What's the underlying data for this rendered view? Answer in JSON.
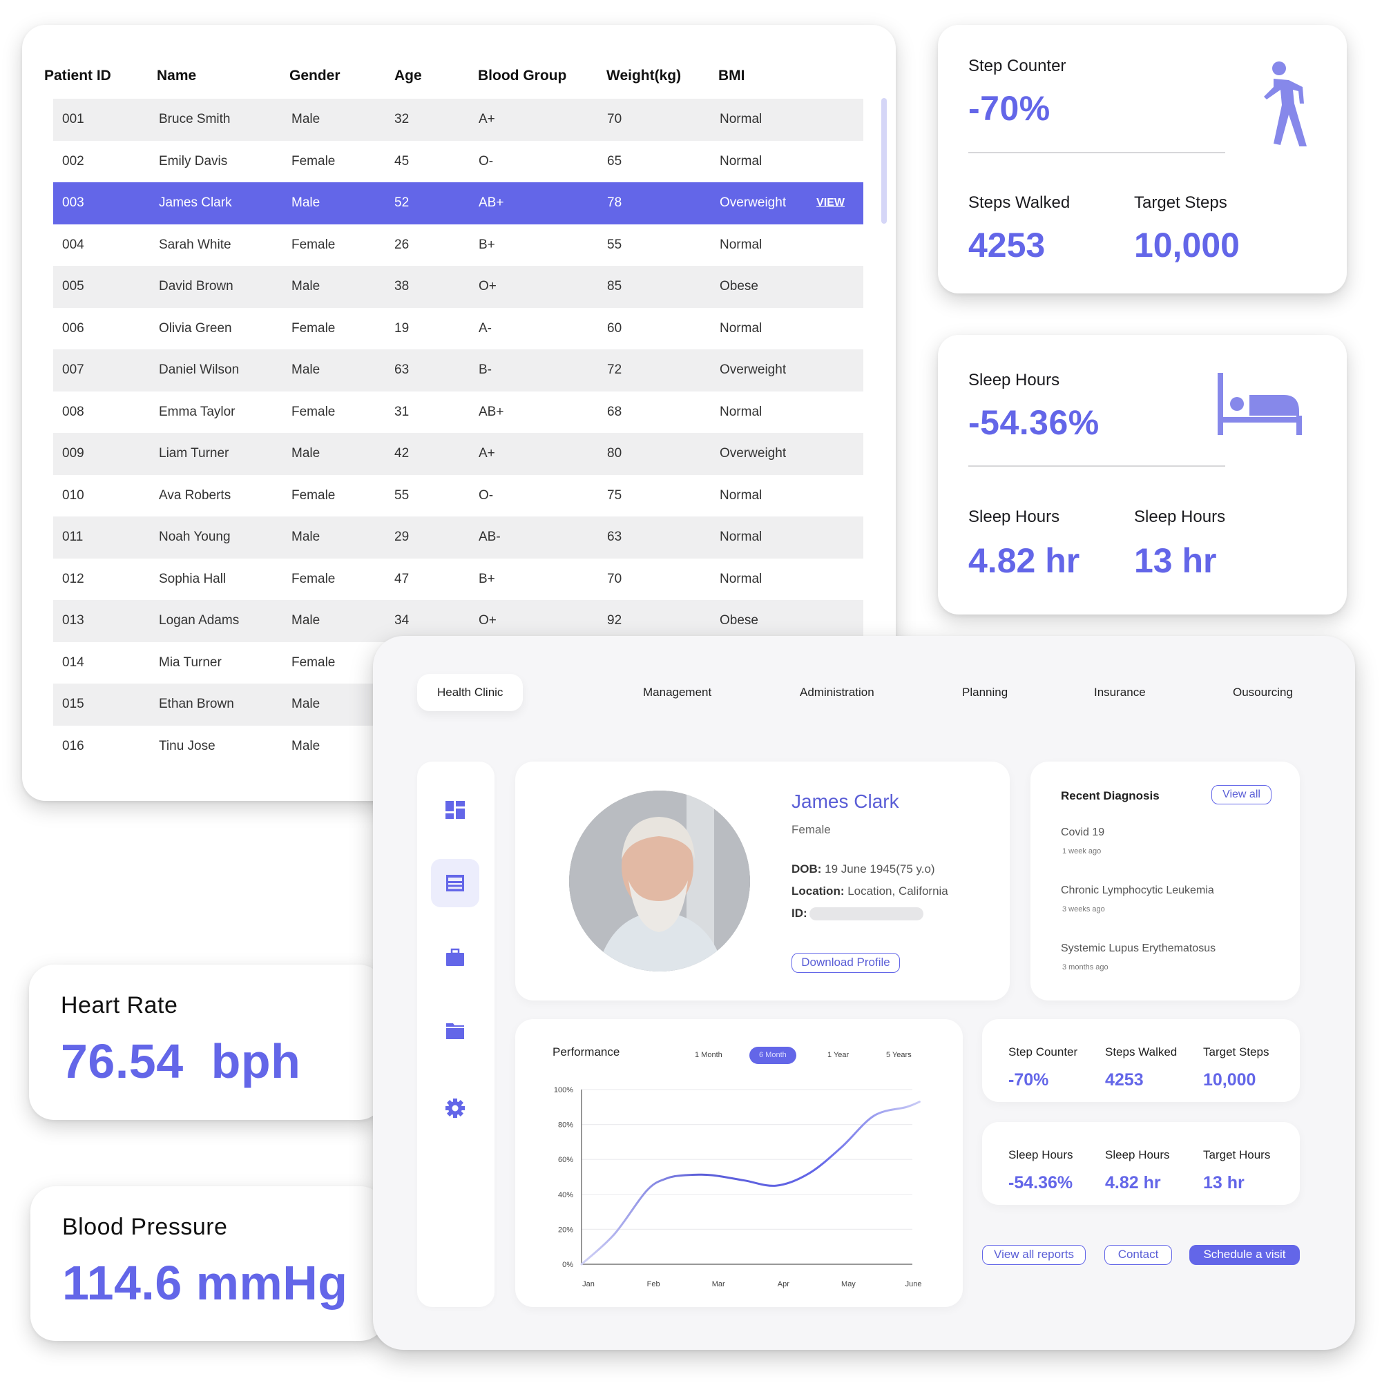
{
  "colors": {
    "accent": "#6366e8",
    "row_alt": "#efeff0",
    "panel_bg": "#f6f6f8"
  },
  "patient_table": {
    "columns": [
      "Patient ID",
      "Name",
      "Gender",
      "Age",
      "Blood Group",
      "Weight(kg)",
      "BMI"
    ],
    "selected_row_action": "VIEW",
    "rows": [
      [
        "001",
        "Bruce Smith",
        "Male",
        "32",
        "A+",
        "70",
        "Normal"
      ],
      [
        "002",
        "Emily Davis",
        "Female",
        "45",
        "O-",
        "65",
        "Normal"
      ],
      [
        "003",
        "James Clark",
        "Male",
        "52",
        "AB+",
        "78",
        "Overweight"
      ],
      [
        "004",
        "Sarah White",
        "Female",
        "26",
        "B+",
        "55",
        "Normal"
      ],
      [
        "005",
        "David Brown",
        "Male",
        "38",
        "O+",
        "85",
        "Obese"
      ],
      [
        "006",
        "Olivia Green",
        "Female",
        "19",
        "A-",
        "60",
        "Normal"
      ],
      [
        "007",
        "Daniel Wilson",
        "Male",
        "63",
        "B-",
        "72",
        "Overweight"
      ],
      [
        "008",
        "Emma Taylor",
        "Female",
        "31",
        "AB+",
        "68",
        "Normal"
      ],
      [
        "009",
        "Liam Turner",
        "Male",
        "42",
        "A+",
        "80",
        "Overweight"
      ],
      [
        "010",
        "Ava Roberts",
        "Female",
        "55",
        "O-",
        "75",
        "Normal"
      ],
      [
        "011",
        "Noah Young",
        "Male",
        "29",
        "AB-",
        "63",
        "Normal"
      ],
      [
        "012",
        "Sophia Hall",
        "Female",
        "47",
        "B+",
        "70",
        "Normal"
      ],
      [
        "013",
        "Logan Adams",
        "Male",
        "34",
        "O+",
        "92",
        "Obese"
      ],
      [
        "014",
        "Mia Turner",
        "Female",
        "",
        "",
        "",
        ""
      ],
      [
        "015",
        "Ethan Brown",
        "Male",
        "",
        "",
        "",
        ""
      ],
      [
        "016",
        "Tinu Jose",
        "Male",
        "",
        "",
        "",
        ""
      ]
    ],
    "selected_index": 2
  },
  "step_card": {
    "title": "Step Counter",
    "change": "-70%",
    "walked_label": "Steps Walked",
    "walked_value": "4253",
    "target_label": "Target Steps",
    "target_value": "10,000",
    "icon": "walking-person-icon"
  },
  "sleep_card": {
    "title": "Sleep Hours",
    "change": "-54.36%",
    "left_label": "Sleep Hours",
    "left_value": "4.82 hr",
    "right_label": "Sleep Hours",
    "right_value": "13 hr",
    "icon": "bed-icon"
  },
  "heart_rate": {
    "title": "Heart Rate",
    "value": "76.54  bph"
  },
  "blood_pressure": {
    "title": "Blood Pressure",
    "value": "114.6 mmHg"
  },
  "dashboard": {
    "nav": [
      "Health Clinic",
      "Management",
      "Administration",
      "Planning",
      "Insurance",
      "Ousourcing"
    ],
    "active_nav": "Health Clinic",
    "sidebar_icons": [
      "dashboard-icon",
      "records-icon",
      "briefcase-icon",
      "folder-icon",
      "settings-icon"
    ],
    "profile": {
      "name": "James Clark",
      "gender": "Female",
      "dob_label": "DOB:",
      "dob_value": " 19 June 1945(75 y.o)",
      "location_label": "Location:",
      "location_value": " Location, California",
      "id_label": "ID:",
      "download_label": "Download Profile"
    },
    "diagnosis": {
      "title": "Recent Diagnosis",
      "view_all": "View all",
      "items": [
        {
          "name": "Covid 19",
          "time": "1 week ago"
        },
        {
          "name": "Chronic Lymphocytic Leukemia",
          "time": "3 weeks ago"
        },
        {
          "name": "Systemic Lupus Erythematosus",
          "time": "3 months ago"
        }
      ]
    },
    "performance": {
      "title": "Performance",
      "ranges": [
        "1 Month",
        "6 Month",
        "1 Year",
        "5 Years"
      ],
      "active_range": "6 Month"
    },
    "step_metrics": [
      {
        "label": "Step Counter",
        "value": "-70%"
      },
      {
        "label": "Steps Walked",
        "value": "4253"
      },
      {
        "label": "Target Steps",
        "value": "10,000"
      }
    ],
    "sleep_metrics": [
      {
        "label": "Sleep Hours",
        "value": "-54.36%"
      },
      {
        "label": "Sleep Hours",
        "value": "4.82 hr"
      },
      {
        "label": "Target Hours",
        "value": "13 hr"
      }
    ],
    "actions": {
      "reports": "View all reports",
      "contact": "Contact",
      "schedule": "Schedule a visit"
    }
  },
  "chart_data": {
    "type": "line",
    "title": "Performance",
    "categories": [
      "Jan",
      "Feb",
      "Mar",
      "Apr",
      "May",
      "June"
    ],
    "x": [
      0,
      0.5,
      1,
      1.3,
      1.6,
      2,
      2.5,
      3,
      3.5,
      4,
      4.5,
      5,
      5.2
    ],
    "values": [
      0,
      17,
      42,
      49,
      51,
      51,
      48,
      45,
      52,
      67,
      85,
      90,
      93
    ],
    "yticks": [
      "0%",
      "20%",
      "40%",
      "60%",
      "80%",
      "100%"
    ],
    "ylim": [
      0,
      100
    ],
    "xlabel": "",
    "ylabel": "",
    "grid": true,
    "legend": "none"
  }
}
